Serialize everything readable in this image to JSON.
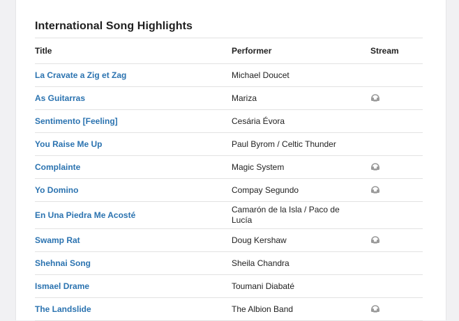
{
  "page": {
    "heading": "International Song Highlights"
  },
  "table": {
    "headers": {
      "title": "Title",
      "performer": "Performer",
      "stream": "Stream"
    },
    "rows": [
      {
        "title": "La Cravate a Zig et Zag",
        "performer": "Michael Doucet",
        "stream": false
      },
      {
        "title": "As Guitarras",
        "performer": "Mariza",
        "stream": true
      },
      {
        "title": "Sentimento [Feeling]",
        "performer": "Cesária Évora",
        "stream": false
      },
      {
        "title": "You Raise Me Up",
        "performer": "Paul Byrom / Celtic Thunder",
        "stream": false
      },
      {
        "title": "Complainte",
        "performer": "Magic System",
        "stream": true
      },
      {
        "title": "Yo Domino",
        "performer": "Compay Segundo",
        "stream": true
      },
      {
        "title": "En Una Piedra Me Acosté",
        "performer": "Camarón de la Isla / Paco de Lucía",
        "stream": false
      },
      {
        "title": "Swamp Rat",
        "performer": "Doug Kershaw",
        "stream": true
      },
      {
        "title": "Shehnai Song",
        "performer": "Sheila Chandra",
        "stream": false
      },
      {
        "title": "Ismael Drame",
        "performer": "Toumani Diabaté",
        "stream": false
      },
      {
        "title": "The Landslide",
        "performer": "The Albion Band",
        "stream": true
      }
    ],
    "stream_icon": "headphones-icon"
  },
  "colors": {
    "link": "#2b73b0",
    "icon": "#9a9a9a"
  }
}
